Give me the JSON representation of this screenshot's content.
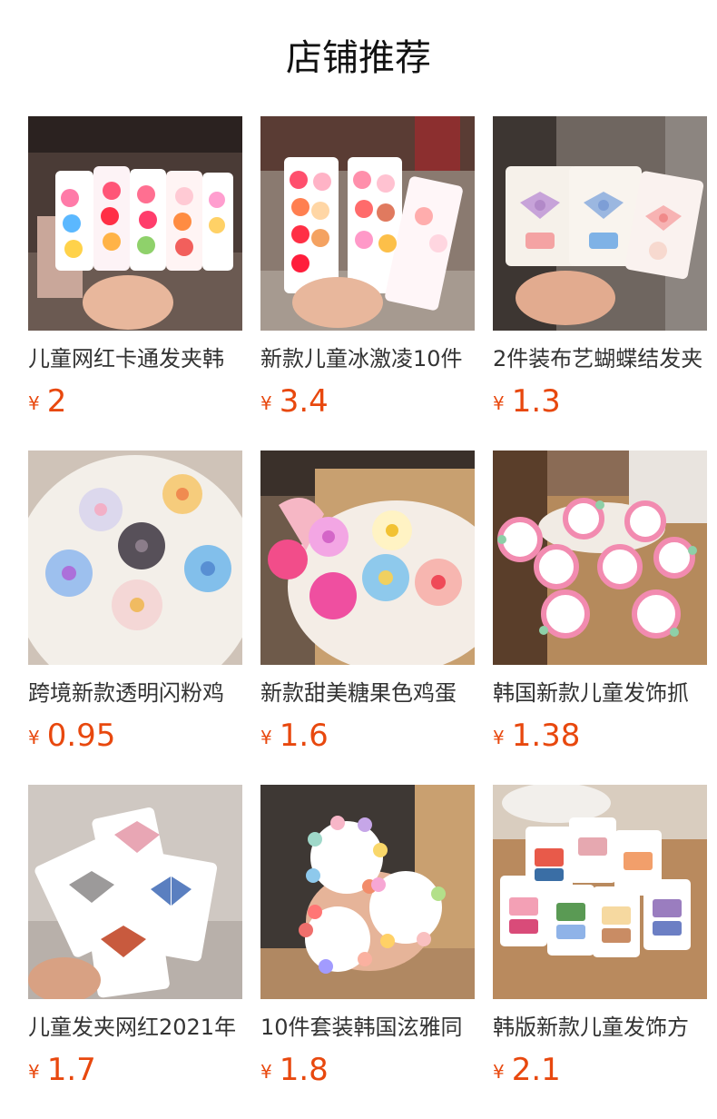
{
  "header": {
    "title": "店铺推荐"
  },
  "colors": {
    "price": "#e8480e",
    "title": "#111111",
    "name": "#333333"
  },
  "currency_symbol": "¥",
  "products": [
    {
      "name": "儿童网红卡通发夹韩",
      "price": "2",
      "image": "hair-clip-cards-photo"
    },
    {
      "name": "新款儿童冰激凌10件",
      "price": "3.4",
      "image": "ice-cream-clips-photo"
    },
    {
      "name": "2件装布艺蝴蝶结发夹",
      "price": "1.3",
      "image": "fabric-bow-clips-photo"
    },
    {
      "name": "跨境新款透明闪粉鸡",
      "price": "0.95",
      "image": "glitter-flower-claws-photo"
    },
    {
      "name": "新款甜美糖果色鸡蛋",
      "price": "1.6",
      "image": "egg-flower-clips-photo"
    },
    {
      "name": "韩国新款儿童发饰抓",
      "price": "1.38",
      "image": "mini-flower-claw-sets-photo"
    },
    {
      "name": "儿童发夹网红2021年",
      "price": "1.7",
      "image": "mesh-bow-clips-photo"
    },
    {
      "name": "10件套装韩国泫雅同",
      "price": "1.8",
      "image": "flower-claw-ring-photo"
    },
    {
      "name": "韩版新款儿童发饰方",
      "price": "2.1",
      "image": "square-fabric-clips-photo"
    }
  ]
}
